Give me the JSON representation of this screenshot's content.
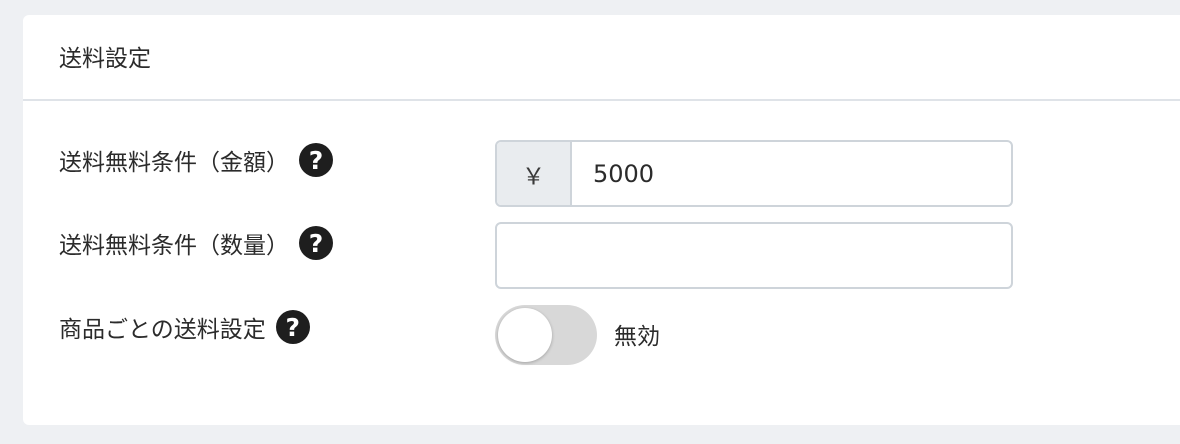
{
  "panel": {
    "title": "送料設定"
  },
  "fields": {
    "free_shipping_amount": {
      "label": "送料無料条件（金額）",
      "currency_symbol": "￥",
      "value": "5000",
      "help_icon": "question-circle-icon"
    },
    "free_shipping_quantity": {
      "label": "送料無料条件（数量）",
      "value": "",
      "help_icon": "question-circle-icon"
    },
    "per_product_shipping": {
      "label": "商品ごとの送料設定",
      "toggle_state": "無効",
      "enabled": false,
      "help_icon": "question-circle-icon"
    }
  },
  "colors": {
    "page_background": "#eef0f3",
    "card_background": "#ffffff",
    "addon_background": "#e9ecef",
    "border": "#ced4da",
    "toggle_off": "#d8d8d8",
    "help_icon": "#1e1e1e"
  }
}
